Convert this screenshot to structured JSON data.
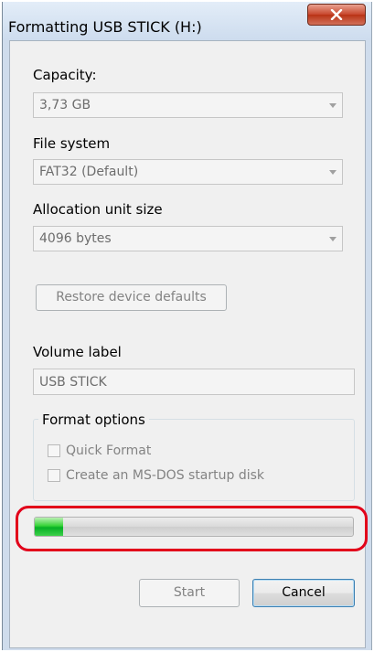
{
  "window": {
    "title": "Formatting USB STICK (H:)",
    "close_icon": "close-x-icon"
  },
  "capacity": {
    "label": "Capacity:",
    "value": "3,73 GB"
  },
  "file_system": {
    "label": "File system",
    "value": "FAT32 (Default)"
  },
  "allocation": {
    "label": "Allocation unit size",
    "value": "4096 bytes"
  },
  "restore_label": "Restore device defaults",
  "volume": {
    "label": "Volume label",
    "value": "USB STICK"
  },
  "format_options": {
    "title": "Format options",
    "quick_format": "Quick Format",
    "msdos": "Create an MS-DOS startup disk"
  },
  "progress": {
    "percent": 9,
    "highlight_color": "#e2001a"
  },
  "buttons": {
    "start": "Start",
    "cancel": "Cancel"
  }
}
